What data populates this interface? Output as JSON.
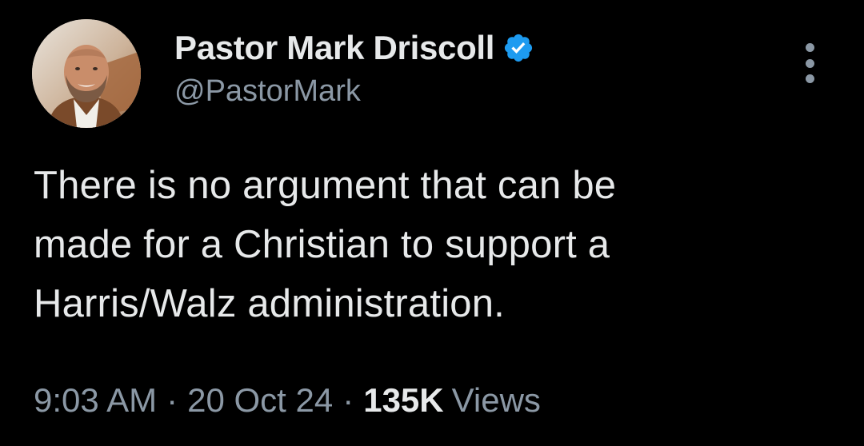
{
  "author": {
    "display_name": "Pastor Mark Driscoll",
    "handle": "@PastorMark",
    "verified_icon": "verified-badge-icon",
    "accent_color": "#1d9bf0"
  },
  "tweet": {
    "lines": [
      "There is no argument that can be",
      "made for a Christian to support a",
      "Harris/Walz administration."
    ]
  },
  "meta": {
    "time": "9:03 AM",
    "separator": "·",
    "date": "20 Oct 24",
    "views_count": "135K",
    "views_label": "Views"
  },
  "menu": {
    "icon": "more-options-icon"
  },
  "colors": {
    "background": "#000000",
    "primary_text": "#e7e9ea",
    "secondary_text": "#8b98a5"
  }
}
